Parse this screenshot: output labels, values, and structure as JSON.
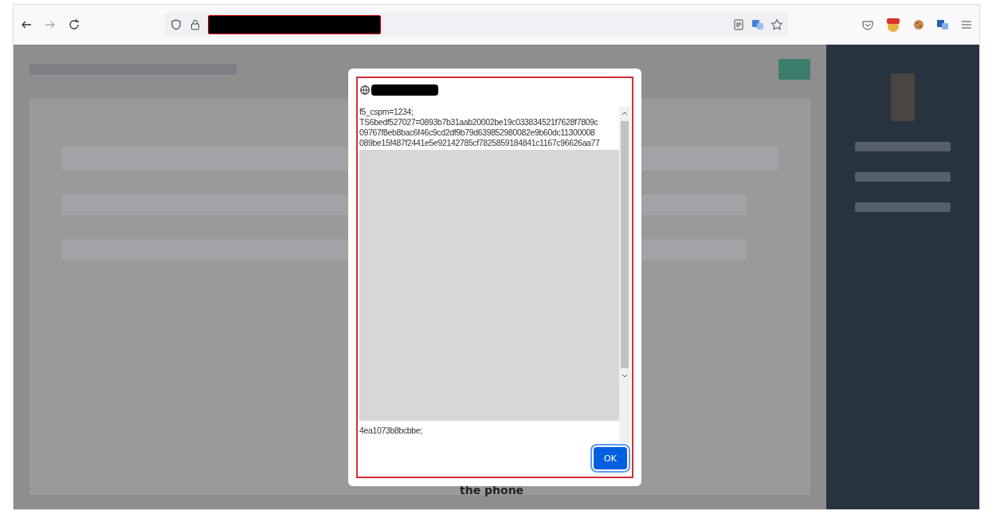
{
  "page": {
    "partial_label": "the phone"
  },
  "dialog": {
    "text_lines": [
      "f5_cspm=1234;",
      "TS6bedf527027=0893b7b31aab20002be19c033834521f7628f7809c",
      "09767f8eb8bac6f46c9cd2df9b79d639852980082e9b60dc11300008",
      "089be15f487f2441e5e92142785cf7825859184841c1167c96626aa77"
    ],
    "last_line": "4ea1073b8bcbbe;",
    "button": "OK"
  }
}
